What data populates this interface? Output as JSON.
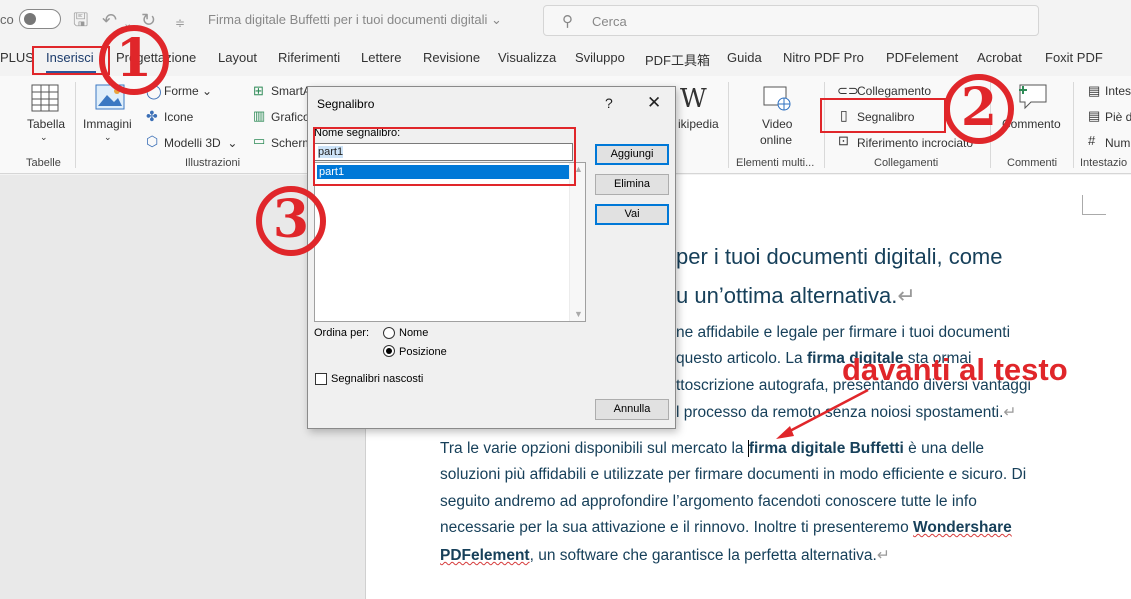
{
  "titlebar": {
    "autosave_label": "co",
    "doc_title": "Firma digitale Buffetti per i tuoi documenti digitali",
    "search_placeholder": "Cerca"
  },
  "tabs": [
    "PLUS",
    "Inserisci",
    "Progettazione",
    "Layout",
    "Riferimenti",
    "Lettere",
    "Revisione",
    "Visualizza",
    "Sviluppo",
    "PDF工具箱",
    "Guida",
    "Nitro PDF Pro",
    "PDFelement",
    "Acrobat",
    "Foxit PDF"
  ],
  "active_tab": "Inserisci",
  "ribbon": {
    "tabella": "Tabella",
    "immagini": "Immagini",
    "forme": "Forme",
    "icone": "Icone",
    "modelli3d": "Modelli 3D",
    "smartart": "SmartA",
    "grafico": "Grafico",
    "schermata": "Scherm",
    "wikipedia": "ikipedia",
    "video_line1": "Video",
    "video_line2": "online",
    "collegamento": "Collegamento",
    "segnalibro": "Segnalibro",
    "riferimento": "Riferimento incrociato",
    "commento": "Commento",
    "intestazione": "Intes",
    "pie": "Piè d",
    "numero": "Num",
    "groups": {
      "tabelle": "Tabelle",
      "illustrazioni": "Illustrazioni",
      "elementi": "Elementi multi...",
      "collegamenti": "Collegamenti",
      "commenti": "Commenti",
      "intestazione": "Intestazio"
    }
  },
  "dialog": {
    "title": "Segnalibro",
    "help": "?",
    "close": "✕",
    "name_label": "Nome segnalibro:",
    "name_value": "part1",
    "list_items": [
      "part1"
    ],
    "btn_add": "Aggiungi",
    "btn_delete": "Elimina",
    "btn_goto": "Vai",
    "btn_cancel": "Annulla",
    "sort_label": "Ordina per:",
    "sort_name": "Nome",
    "sort_position": "Posizione",
    "hidden_label": "Segnalibri nascosti"
  },
  "document": {
    "heading_line1": "per i tuoi documenti digitali, come",
    "heading_line2": "u un’ottima alternativa.",
    "p1_line1": "ne affidabile e legale per firmare i tuoi documenti",
    "p1_line2a": " questo articolo. La ",
    "p1_line2b": "firma digitale",
    "p1_line2c": " sta ormai",
    "p1_line3": "ttoscrizione autografa, presentando diversi vantaggi",
    "p1_line4": "l processo da remoto senza noiosi spostamenti.",
    "p2_line1a": "Tra le varie opzioni disponibili sul mercato la ",
    "p2_line1b": "firma digitale Buffetti",
    "p2_line1c": " è una delle",
    "p2_line2": "soluzioni più affidabili e utilizzate per firmare documenti in modo efficiente e sicuro. Di",
    "p2_line3": "seguito andremo ad approfondire l’argomento facendoti conoscere tutte le info",
    "p2_line4a": "necessarie per la sua attivazione e il rinnovo. Inoltre ti presenteremo ",
    "p2_line4b": "Wondershare",
    "p2_line5a": "PDFelement",
    "p2_line5b": ", un software che garantisce la perfetta alternativa.",
    "pilcrow": "↵"
  },
  "annotations": {
    "step1": "1",
    "step2": "2",
    "step3": "3",
    "note": "davanti al testo",
    "color": "#e0262a"
  }
}
